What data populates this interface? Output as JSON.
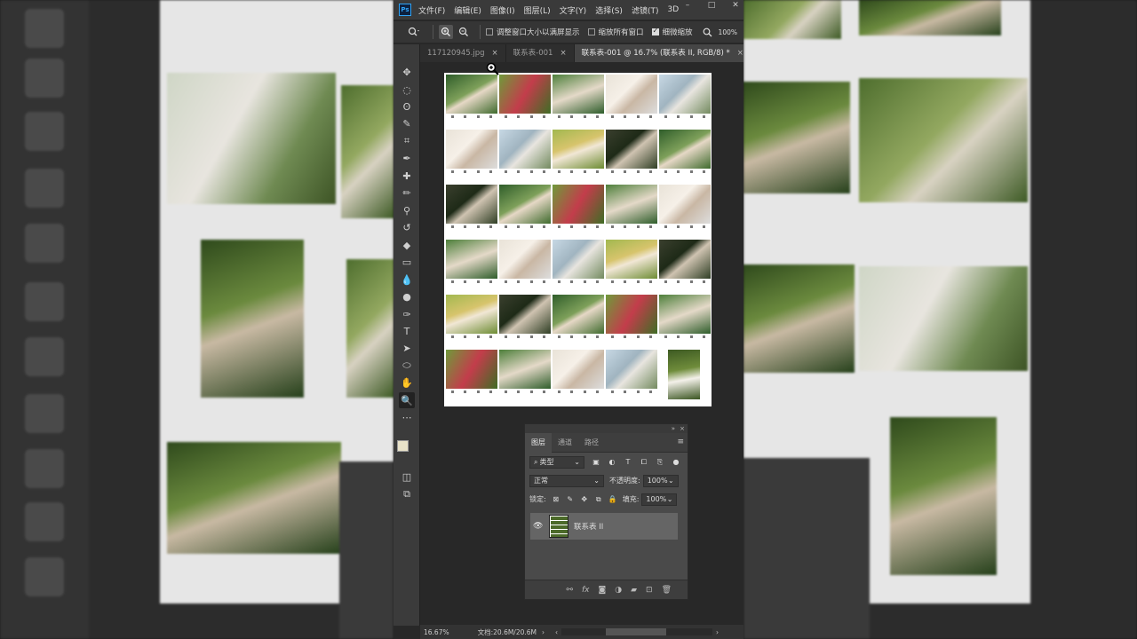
{
  "menubar": {
    "logo": "Ps",
    "items": [
      "文件(F)",
      "编辑(E)",
      "图像(I)",
      "图层(L)",
      "文字(Y)",
      "选择(S)",
      "滤镜(T)",
      "3D"
    ],
    "window_controls": [
      "–",
      "□",
      "✕"
    ]
  },
  "options_bar": {
    "resize_windows_label": "调整窗口大小以满屏显示",
    "resize_windows_checked": false,
    "zoom_all_label": "缩放所有窗口",
    "zoom_all_checked": false,
    "scrubby_zoom_label": "细微缩放",
    "scrubby_zoom_checked": true,
    "zoom_value": "100%"
  },
  "tabs": [
    {
      "label": "117120945.jpg",
      "active": false
    },
    {
      "label": "联系表-001",
      "active": false
    },
    {
      "label": "联系表-001 @ 16.7% (联系表 II, RGB/8) *",
      "active": true
    }
  ],
  "status_bar": {
    "zoom": "16.67%",
    "doc_info": "文档:20.6M/20.6M"
  },
  "layers_panel": {
    "tabs": [
      "图层",
      "通道",
      "路径"
    ],
    "filter_kind": "类型",
    "blend_mode": "正常",
    "opacity_label": "不透明度:",
    "opacity_value": "100%",
    "lock_label": "锁定:",
    "fill_label": "填充:",
    "fill_value": "100%",
    "layer_name": "联系表 II",
    "footer_icons": [
      "link-icon",
      "fx-icon",
      "mask-icon",
      "adjustment-icon",
      "folder-icon",
      "new-layer-icon",
      "trash-icon"
    ]
  },
  "tools": [
    "move-icon",
    "marquee-icon",
    "lasso-icon",
    "quick-select-icon",
    "crop-icon",
    "eyedropper-icon",
    "healing-icon",
    "brush-icon",
    "stamp-icon",
    "history-brush-icon",
    "eraser-icon",
    "gradient-icon",
    "blur-icon",
    "dodge-icon",
    "pen-icon",
    "type-icon",
    "path-select-icon",
    "shape-icon",
    "hand-icon",
    "zoom-icon",
    "more-icon"
  ],
  "tool_glyphs": [
    "✥",
    "◌",
    "ʘ",
    "✎",
    "⌗",
    "✒",
    "✚",
    "✏",
    "⚲",
    "↺",
    "◆",
    "▭",
    "💧",
    "●",
    "✑",
    "T",
    "➤",
    "⬭",
    "✋",
    "🔍",
    "⋯"
  ]
}
